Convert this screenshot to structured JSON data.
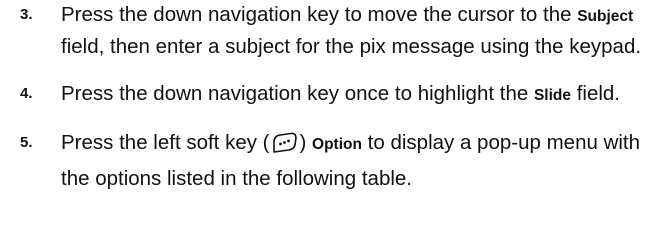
{
  "steps": [
    {
      "number": "3.",
      "text_before": "Press the down navigation key to move the cursor to the ",
      "term": "Subject",
      "text_after": " field, then enter a subject for the pix message using the keypad."
    },
    {
      "number": "4.",
      "text_before": "Press the down navigation key once to highlight the ",
      "term": "Slide",
      "text_after": " field."
    },
    {
      "number": "5.",
      "text_before": "Press the left soft key (",
      "icon": "left-soft-key-icon",
      "text_mid": ") ",
      "term": "Option",
      "text_after": " to display a pop-up menu with the options listed in the following table."
    }
  ]
}
